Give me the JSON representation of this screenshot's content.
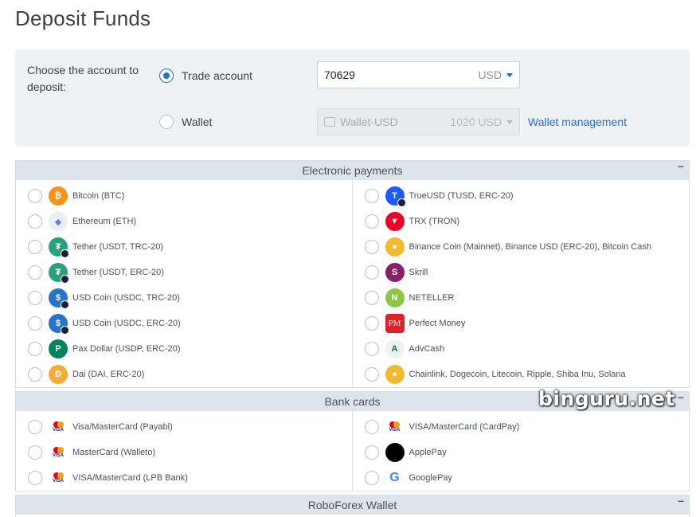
{
  "page": {
    "title": "Deposit Funds"
  },
  "account": {
    "choose_label": "Choose the account to deposit:",
    "trade_label": "Trade account",
    "trade_selected": true,
    "trade_value": "70629",
    "trade_currency": "USD",
    "wallet_label": "Wallet",
    "wallet_value": "Wallet-USD",
    "wallet_amount": "1020 USD",
    "wallet_link": "Wallet management"
  },
  "sections": {
    "electronic": {
      "title": "Electronic payments",
      "left": [
        {
          "label": "Bitcoin (BTC)",
          "icon": "bitcoin-icon",
          "color": "#f7931a"
        },
        {
          "label": "Ethereum (ETH)",
          "icon": "ethereum-icon",
          "color": "#627eea"
        },
        {
          "label": "Tether (USDT, TRC-20)",
          "icon": "tether-icon",
          "color": "#26a17b"
        },
        {
          "label": "Tether (USDT, ERC-20)",
          "icon": "tether-icon",
          "color": "#26a17b"
        },
        {
          "label": "USD Coin (USDC, TRC-20)",
          "icon": "usdc-icon",
          "color": "#2775ca"
        },
        {
          "label": "USD Coin (USDC, ERC-20)",
          "icon": "usdc-icon",
          "color": "#2775ca"
        },
        {
          "label": "Pax Dollar (USDP, ERC-20)",
          "icon": "pax-dollar-icon",
          "color": "#00845d"
        },
        {
          "label": "Dai (DAI, ERC-20)",
          "icon": "dai-icon",
          "color": "#f5ac37"
        }
      ],
      "right": [
        {
          "label": "TrueUSD (TUSD, ERC-20)",
          "icon": "trueusd-icon",
          "color": "#1a5aff"
        },
        {
          "label": "TRX (TRON)",
          "icon": "tron-icon",
          "color": "#ef0027"
        },
        {
          "label": "Binance Coin (Mainnet), Binance USD (ERC-20), Bitcoin Cash",
          "icon": "multi-crypto-icon",
          "color": "#f3ba2f"
        },
        {
          "label": "Skrill",
          "icon": "skrill-icon",
          "color": "#862165"
        },
        {
          "label": "NETELLER",
          "icon": "neteller-icon",
          "color": "#8dc63f"
        },
        {
          "label": "Perfect Money",
          "icon": "perfect-money-icon",
          "color": "#e0202b"
        },
        {
          "label": "AdvCash",
          "icon": "advcash-icon",
          "color": "#0b6b4e"
        },
        {
          "label": "Chainlink, Dogecoin, Litecoin, Ripple, Shiba Inu, Solana",
          "icon": "multi-crypto-icon",
          "color": "#f3ba2f"
        }
      ]
    },
    "cards": {
      "title": "Bank cards",
      "left": [
        {
          "label": "Visa/MasterCard (Payabl)",
          "icon": "visa-mastercard-icon"
        },
        {
          "label": "MasterCard (Walleto)",
          "icon": "visa-mastercard-icon"
        },
        {
          "label": "VISA/MasterCard (LPB Bank)",
          "icon": "visa-mastercard-icon"
        }
      ],
      "right": [
        {
          "label": "VISA/MasterCard (CardPay)",
          "icon": "visa-mastercard-icon"
        },
        {
          "label": "ApplePay",
          "icon": "apple-pay-icon"
        },
        {
          "label": "GooglePay",
          "icon": "google-pay-icon"
        }
      ]
    },
    "roboforex": {
      "title": "RoboForex Wallet"
    }
  },
  "collapse_symbol": "−",
  "watermark": "binguru.net"
}
